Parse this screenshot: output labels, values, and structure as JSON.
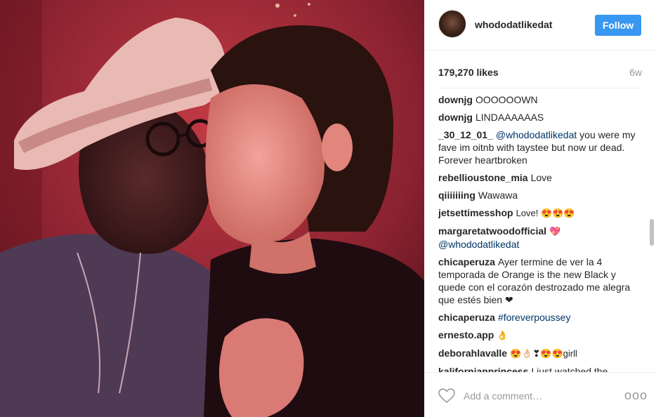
{
  "post": {
    "username": "whododatlikedat",
    "follow_label": "Follow",
    "likes": "179,270 likes",
    "time": "6w"
  },
  "comments": [
    {
      "user": "downjg",
      "text": "OOOOOOWN"
    },
    {
      "user": "downjg",
      "text": "LINDAAAAAAS"
    },
    {
      "user": "_30_12_01_",
      "mention": "@whododatlikedat",
      "text": " you were my fave im oitnb with taystee but now ur dead. Forever heartbroken"
    },
    {
      "user": "rebellioustone_mia",
      "text": "Love"
    },
    {
      "user": "qiiiiiiing",
      "text": "Wawawa"
    },
    {
      "user": "jetsettimesshop",
      "text": "Love! 😍😍😍"
    },
    {
      "user": "margaretatwoodofficial",
      "text": "💖",
      "mention2": "@whododatlikedat"
    },
    {
      "user": "chicaperuza",
      "text": "Ayer termine de ver la 4 temporada de Orange is the new Black y quede con el corazón destrozado me alegra que estés bien ❤"
    },
    {
      "user": "chicaperuza",
      "mention": "#foreverpoussey",
      "text": ""
    },
    {
      "user": "ernesto.app",
      "text": "👌"
    },
    {
      "user": "deborahlavalle",
      "text": "😍👌🏻❣😍😍girll"
    },
    {
      "user": "kalifornianprincess",
      "text": "I just watched the"
    }
  ],
  "add_comment": {
    "placeholder": "Add a comment…",
    "more_label": "ooo"
  },
  "colors": {
    "accent": "#3897f0",
    "mention": "#003569"
  },
  "icons": [
    "heart-icon",
    "more-options-icon"
  ]
}
